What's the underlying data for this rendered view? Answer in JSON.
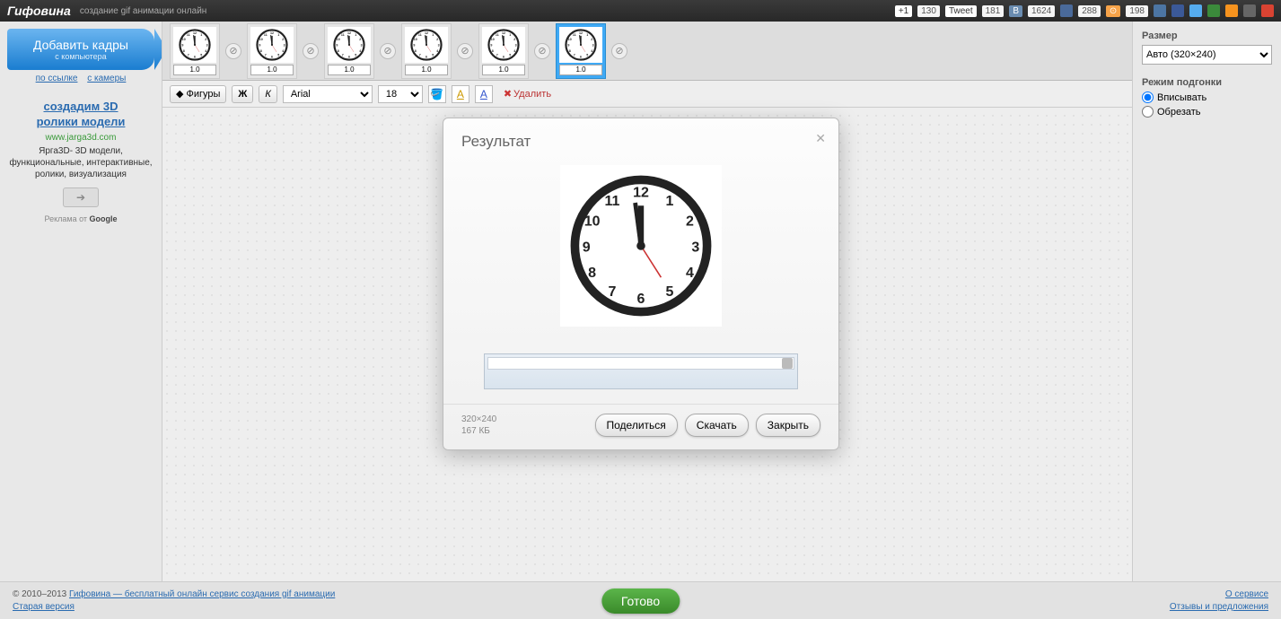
{
  "header": {
    "logo": "Гифовина",
    "tagline": "создание gif анимации онлайн",
    "social": {
      "gplus_count": "130",
      "tweet_label": "Tweet",
      "tweet_count": "181",
      "vk_label": "В",
      "vk_count": "1624",
      "ok_count": "288",
      "share_count": "198"
    }
  },
  "sidebar": {
    "add_title": "Добавить кадры",
    "add_sub": "с компьютера",
    "link_url": "по ссылке",
    "link_cam": "с камеры",
    "ad": {
      "title1": "создадим 3D",
      "title2": "ролики модели",
      "url": "www.jarga3d.com",
      "text": "Ярга3D- 3D модели, функциональные, интерактивные, ролики, визуализация",
      "footer_prefix": "Реклама от ",
      "footer_brand": "Google"
    }
  },
  "frames": [
    {
      "dur": "1.0"
    },
    {
      "dur": "1.0"
    },
    {
      "dur": "1.0"
    },
    {
      "dur": "1.0"
    },
    {
      "dur": "1.0"
    },
    {
      "dur": "1.0"
    }
  ],
  "toolbar": {
    "shapes": "Фигуры",
    "bold": "Ж",
    "italic": "К",
    "font": "Arial",
    "size": "18",
    "delete": "Удалить"
  },
  "rightPanel": {
    "size_label": "Размер",
    "size_value": "Авто (320×240)",
    "fit_label": "Режим подгонки",
    "fit_opt1": "Вписывать",
    "fit_opt2": "Обрезать"
  },
  "modal": {
    "title": "Результат",
    "meta_dim": "320×240",
    "meta_size": "167 КБ",
    "btn_share": "Поделиться",
    "btn_download": "Скачать",
    "btn_close": "Закрыть"
  },
  "footer": {
    "copyright": "© 2010–2013 ",
    "link_main": "Гифовина — бесплатный онлайн сервис создания gif анимации",
    "link_old": "Старая версия",
    "link_about": "О сервисе",
    "link_feedback": "Отзывы и предложения",
    "ready": "Готово"
  }
}
